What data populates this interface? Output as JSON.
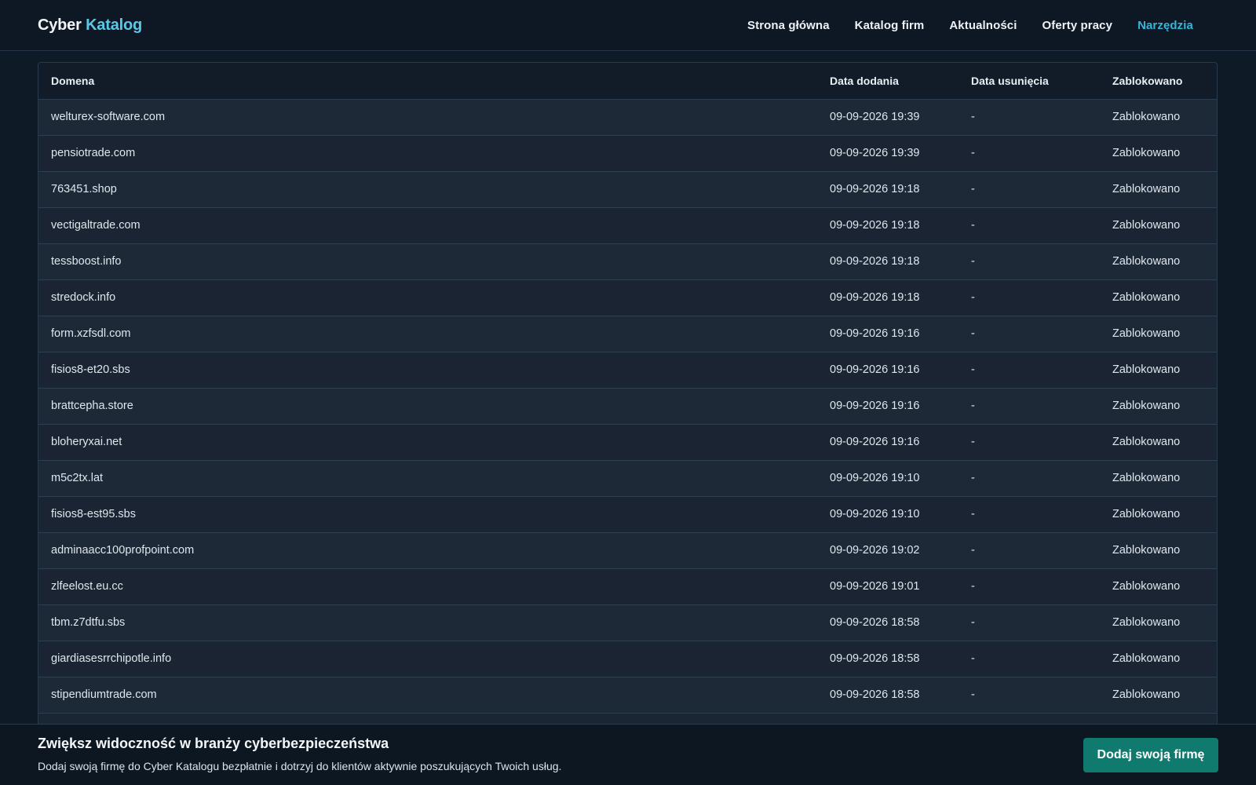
{
  "brand": {
    "part1": "Cyber",
    "part2": "Katalog"
  },
  "nav": {
    "items": [
      {
        "label": "Strona główna"
      },
      {
        "label": "Katalog firm"
      },
      {
        "label": "Aktualności"
      },
      {
        "label": "Oferty pracy"
      },
      {
        "label": "Narzędzia",
        "active": true
      }
    ]
  },
  "table": {
    "headers": [
      "Domena",
      "Data dodania",
      "Data usunięcia",
      "Zablokowano"
    ],
    "rows": [
      [
        "welturex-software.com",
        "09-09-2026 19:39",
        "-",
        "Zablokowano"
      ],
      [
        "pensiotrade.com",
        "09-09-2026 19:39",
        "-",
        "Zablokowano"
      ],
      [
        "763451.shop",
        "09-09-2026 19:18",
        "-",
        "Zablokowano"
      ],
      [
        "vectigaltrade.com",
        "09-09-2026 19:18",
        "-",
        "Zablokowano"
      ],
      [
        "tessboost.info",
        "09-09-2026 19:18",
        "-",
        "Zablokowano"
      ],
      [
        "stredock.info",
        "09-09-2026 19:18",
        "-",
        "Zablokowano"
      ],
      [
        "form.xzfsdl.com",
        "09-09-2026 19:16",
        "-",
        "Zablokowano"
      ],
      [
        "fisios8-et20.sbs",
        "09-09-2026 19:16",
        "-",
        "Zablokowano"
      ],
      [
        "brattcepha.store",
        "09-09-2026 19:16",
        "-",
        "Zablokowano"
      ],
      [
        "bloheryxai.net",
        "09-09-2026 19:16",
        "-",
        "Zablokowano"
      ],
      [
        "m5c2tx.lat",
        "09-09-2026 19:10",
        "-",
        "Zablokowano"
      ],
      [
        "fisios8-est95.sbs",
        "09-09-2026 19:10",
        "-",
        "Zablokowano"
      ],
      [
        "adminaacc100profpoint.com",
        "09-09-2026 19:02",
        "-",
        "Zablokowano"
      ],
      [
        "zlfeelost.eu.cc",
        "09-09-2026 19:01",
        "-",
        "Zablokowano"
      ],
      [
        "tbm.z7dtfu.sbs",
        "09-09-2026 18:58",
        "-",
        "Zablokowano"
      ],
      [
        "giardiasesrrchipotle.info",
        "09-09-2026 18:58",
        "-",
        "Zablokowano"
      ],
      [
        "stipendiumtrade.com",
        "09-09-2026 18:58",
        "-",
        "Zablokowano"
      ]
    ]
  },
  "promo": {
    "title": "Zwiększ widoczność w branży cyberbezpieczeństwa",
    "text": "Dodaj swoją firmę do Cyber Katalogu bezpłatnie i dotrzyj do klientów aktywnie poszukujących Twoich usług.",
    "button_label": "Dodaj swoją firmę"
  },
  "colors": {
    "accent": "#35b5d8",
    "cta": "#117a6e",
    "background": "#0f1a27"
  }
}
